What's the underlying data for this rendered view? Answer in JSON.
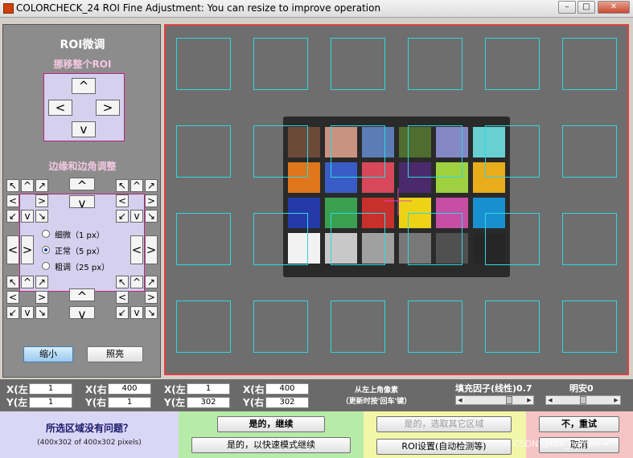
{
  "window": {
    "title": "COLORCHECK_24 ROI Fine Adjustment: You can resize to improve operation",
    "controls": [
      "–",
      "□",
      "✕"
    ]
  },
  "left_panel": {
    "title": "ROI微调",
    "move_whole_label": "挪移整个ROI",
    "edge_corner_label": "边缘和边角调整",
    "arrows": {
      "up": "^",
      "down": "v",
      "left": "<",
      "right": ">",
      "ul": "↖",
      "ur": "↗",
      "dl": "↙",
      "dr": "↘"
    },
    "step_options": [
      {
        "label": "细微（1 px）",
        "selected": false
      },
      {
        "label": "正常（5 px）",
        "selected": true
      },
      {
        "label": "粗调（25 px）",
        "selected": false
      }
    ],
    "zoom_out_button": "缩小",
    "highlight_button": "照亮"
  },
  "coords": {
    "left_label": "X(左",
    "right_label": "X(右",
    "top_label": "Y(左",
    "bottom_label": "Y(右",
    "set1": {
      "x_left": "1",
      "x_right": "400",
      "y_left": "1",
      "y_right": "1"
    },
    "set2": {
      "x_left": "1",
      "x_right": "400",
      "y_left": "302",
      "y_right": "302"
    },
    "hint_line1": "从左上角像素",
    "hint_line2": "（更新时按'回车'键）",
    "fill_factor_label": "填充因子(线性)0.7",
    "brightness_label": "明安0"
  },
  "prompt": {
    "question": "所选区域没有问题？",
    "detail": "(400x302 of 400x302 pixels)"
  },
  "actions": {
    "yes_continue": "是的，继续",
    "yes_fast": "是的，以快速模式继续",
    "yes_other_area": "是的，选取其它区域",
    "roi_setup": "ROI设置(自动检测等)",
    "no_retry": "不，重试",
    "cancel": "取消"
  },
  "watermark": "CSDN @the_name==\"\"",
  "colors": {
    "roi_outline": "#2ed7e0",
    "panel_border": "#e04040",
    "pink_pad_border": "#c02080"
  }
}
